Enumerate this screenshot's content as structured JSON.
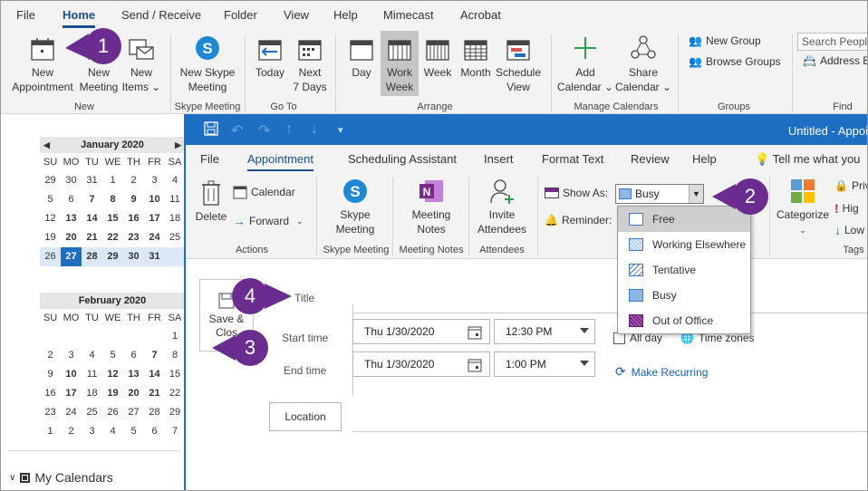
{
  "menubar": {
    "items": [
      "File",
      "Home",
      "Send / Receive",
      "Folder",
      "View",
      "Help",
      "Mimecast",
      "Acrobat"
    ]
  },
  "ribbon": {
    "new_appointment": [
      "New",
      "Appointment"
    ],
    "new_meeting": [
      "New",
      "Meeting"
    ],
    "new_items": [
      "New",
      "Items ⌄"
    ],
    "new_group_label": "New",
    "new_skype": [
      "New Skype",
      "Meeting"
    ],
    "skype_group_label": "Skype Meeting",
    "today": "Today",
    "next7": [
      "Next",
      "7 Days"
    ],
    "goto_group_label": "Go To",
    "day": "Day",
    "work_week": [
      "Work",
      "Week"
    ],
    "week": "Week",
    "month": "Month",
    "schedule_view": [
      "Schedule",
      "View"
    ],
    "arrange_group_label": "Arrange",
    "add_calendar": [
      "Add",
      "Calendar ⌄"
    ],
    "share_calendar": [
      "Share",
      "Calendar ⌄"
    ],
    "manage_group_label": "Manage Calendars",
    "new_group": "New Group",
    "browse_groups": "Browse Groups",
    "groups_label": "Groups",
    "search_people": "Search People",
    "address_book": "Address Bo",
    "find_label": "Find"
  },
  "calendar_jan": {
    "month": "January 2020",
    "dow": [
      "SU",
      "MO",
      "TU",
      "WE",
      "TH",
      "FR",
      "SA"
    ],
    "rows": [
      [
        "29",
        "30",
        "31",
        "1",
        "2",
        "3",
        "4"
      ],
      [
        "5",
        "6",
        "7",
        "8",
        "9",
        "10",
        "11"
      ],
      [
        "12",
        "13",
        "14",
        "15",
        "16",
        "17",
        "18"
      ],
      [
        "19",
        "20",
        "21",
        "22",
        "23",
        "24",
        "25"
      ],
      [
        "26",
        "27",
        "28",
        "29",
        "30",
        "31",
        ""
      ]
    ]
  },
  "calendar_feb": {
    "month": "February 2020",
    "dow": [
      "SU",
      "MO",
      "TU",
      "WE",
      "TH",
      "FR",
      "SA"
    ],
    "rows": [
      [
        "",
        "",
        "",
        "",
        "",
        "",
        "1"
      ],
      [
        "2",
        "3",
        "4",
        "5",
        "6",
        "7",
        "8"
      ],
      [
        "9",
        "10",
        "11",
        "12",
        "13",
        "14",
        "15"
      ],
      [
        "16",
        "17",
        "18",
        "19",
        "20",
        "21",
        "22"
      ],
      [
        "23",
        "24",
        "25",
        "26",
        "27",
        "28",
        "29"
      ],
      [
        "1",
        "2",
        "3",
        "4",
        "5",
        "6",
        "7"
      ]
    ]
  },
  "left_pane": {
    "my_calendars": "My Calendars"
  },
  "appt": {
    "window_title": "Untitled  -  Appoi",
    "tabs": [
      "File",
      "Appointment",
      "Scheduling Assistant",
      "Insert",
      "Format Text",
      "Review",
      "Help",
      "Tell me what you"
    ],
    "delete": "Delete",
    "calendar": "Calendar",
    "forward": "Forward",
    "actions_label": "Actions",
    "skype_meeting": [
      "Skype",
      "Meeting"
    ],
    "skype_label": "Skype Meeting",
    "meeting_notes": [
      "Meeting",
      "Notes"
    ],
    "meeting_notes_label": "Meeting Notes",
    "invite": [
      "Invite",
      "Attendees"
    ],
    "attendees_label": "Attendees",
    "show_as": "Show As:",
    "show_as_value": "Busy",
    "reminder": "Reminder:",
    "categorize": "Categorize",
    "private": "Priv",
    "high": "Hig",
    "low": "Low",
    "tags_label": "Tags",
    "show_as_options": [
      "Free",
      "Working Elsewhere",
      "Tentative",
      "Busy",
      "Out of Office"
    ],
    "save_close": [
      "Save &",
      "Clos"
    ],
    "title_label": "Title",
    "start_label": "Start time",
    "end_label": "End time",
    "start_date": "Thu 1/30/2020",
    "start_time": "12:30 PM",
    "end_date": "Thu 1/30/2020",
    "end_time": "1:00 PM",
    "all_day": "All day",
    "time_zones": "Time zones",
    "make_recurring": "Make Recurring",
    "location": "Location"
  },
  "callouts": [
    "1",
    "2",
    "3",
    "4"
  ],
  "colors": {
    "accent": "#1c6fc3",
    "callout": "#6a2c8f",
    "busy": "#8cb6e4",
    "oof": "#7b2a8c"
  }
}
